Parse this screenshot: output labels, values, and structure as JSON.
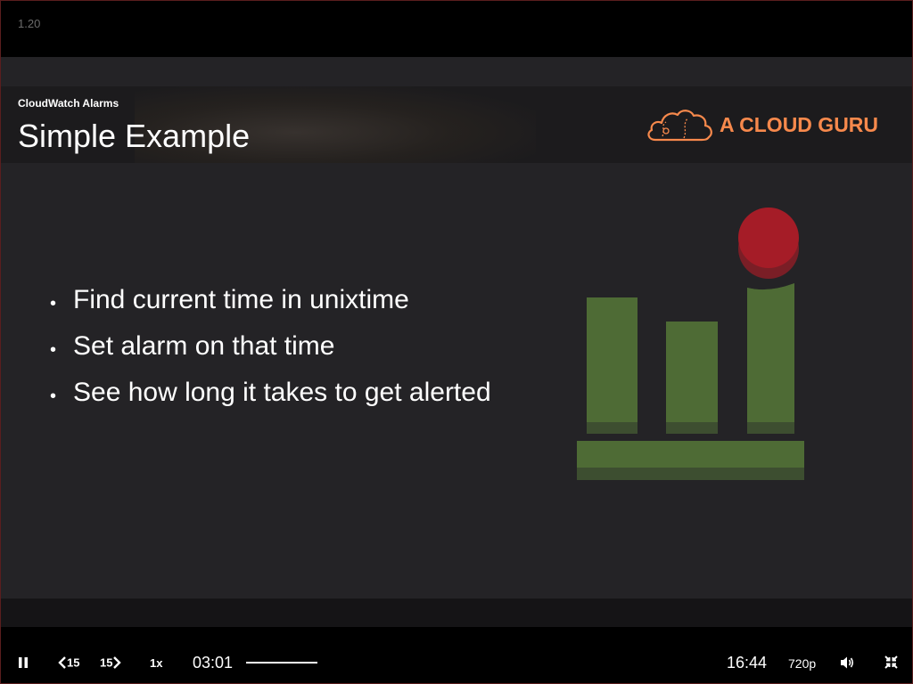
{
  "top_bar": {
    "chapter_number": "1.20"
  },
  "slide": {
    "subtitle": "CloudWatch Alarms",
    "title": "Simple Example",
    "brand": {
      "name": "A CLOUD GURU",
      "color": "#f7894c"
    },
    "bullets": [
      "Find current time in unixtime",
      "Set alarm on that time",
      "See how long it takes to get alerted"
    ],
    "illustration": {
      "bar_color": "#4e6b35",
      "bar_shadow_color": "#3d4e30",
      "alarm_color": "#a51c27",
      "alarm_shadow_color": "#7a1e26"
    }
  },
  "player": {
    "pause_icon": "pause-icon",
    "rewind_label": "15",
    "forward_label": "15",
    "speed_label": "1x",
    "current_time": "03:01",
    "duration": "16:44",
    "quality_label": "720p",
    "volume_icon": "volume-icon",
    "exit_fullscreen_icon": "exit-fullscreen-icon"
  }
}
